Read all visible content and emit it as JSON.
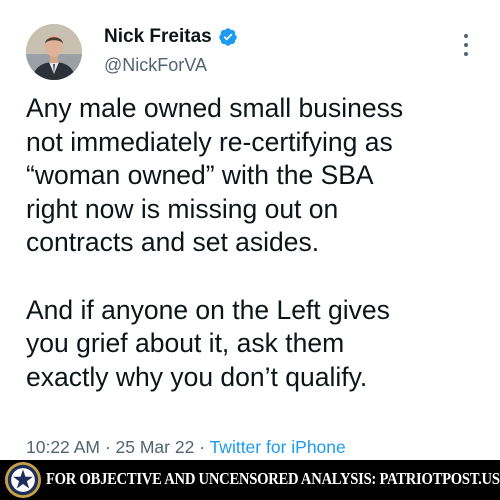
{
  "tweet": {
    "author": {
      "display_name": "Nick Freitas",
      "handle": "@NickForVA",
      "verified": true
    },
    "paragraphs": [
      "Any male owned small business\nnot immediately re-certifying as\n“woman owned” with the SBA\nright now is missing out on\ncontracts and set asides.",
      "And if anyone on the Left gives\nyou grief about it, ask them\nexactly why you don’t qualify."
    ],
    "time": "10:22 AM",
    "date": "25 Mar 22",
    "source": "Twitter for iPhone",
    "separator": "·"
  },
  "footer": {
    "text": "FOR OBJECTIVE AND UNCENSORED ANALYSIS: PATRIOTPOST.US"
  },
  "colors": {
    "text": "#0f1419",
    "secondary": "#536471",
    "link": "#1d9bf0",
    "verified": "#1d9bf0",
    "footer_bg": "#000000"
  },
  "icons": {
    "verified": "verified-badge-icon",
    "more": "more-options-icon",
    "footer_logo": "star-seal-logo"
  }
}
